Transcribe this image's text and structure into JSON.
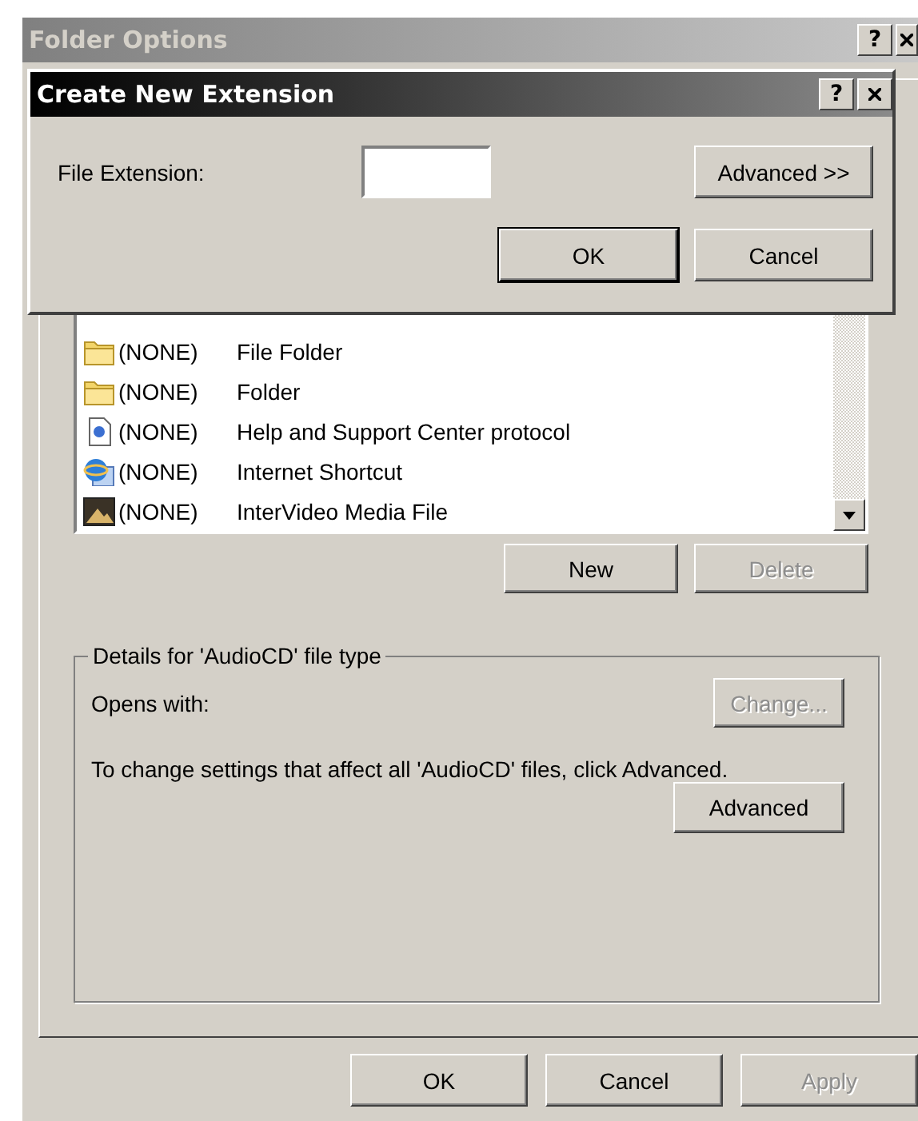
{
  "window": {
    "title": "Folder Options",
    "help_button": "?"
  },
  "dialog": {
    "title": "Create New Extension",
    "help_button": "?",
    "field_label": "File Extension:",
    "buttons": [
      {
        "label": "Advanced >>",
        "default": false
      },
      {
        "label": "OK",
        "default": true
      },
      {
        "label": "Cancel",
        "default": false
      }
    ]
  },
  "file_types": [
    {
      "kind": "folder",
      "extension": "(NONE)",
      "type": "File Folder"
    },
    {
      "kind": "folder",
      "extension": "(NONE)",
      "type": "Folder"
    },
    {
      "kind": "help",
      "extension": "(NONE)",
      "type": "Help and Support Center protocol"
    },
    {
      "kind": "internet",
      "extension": "(NONE)",
      "type": "Internet Shortcut"
    },
    {
      "kind": "video",
      "extension": "(NONE)",
      "type": "InterVideo Media File"
    }
  ],
  "list_buttons": [
    {
      "label": "New",
      "disabled": false
    },
    {
      "label": "Delete",
      "disabled": true
    }
  ],
  "details": {
    "title": "Details for 'AudioCD' file type",
    "opens_with_label": "Opens with:",
    "change_button": {
      "label": "Change...",
      "disabled": true
    },
    "description": "To change settings that affect all 'AudioCD' files, click Advanced.",
    "advanced_button": {
      "label": "Advanced",
      "disabled": false
    }
  },
  "footer_buttons": [
    {
      "label": "OK",
      "disabled": false
    },
    {
      "label": "Cancel",
      "disabled": false
    },
    {
      "label": "Apply",
      "disabled": true
    }
  ]
}
